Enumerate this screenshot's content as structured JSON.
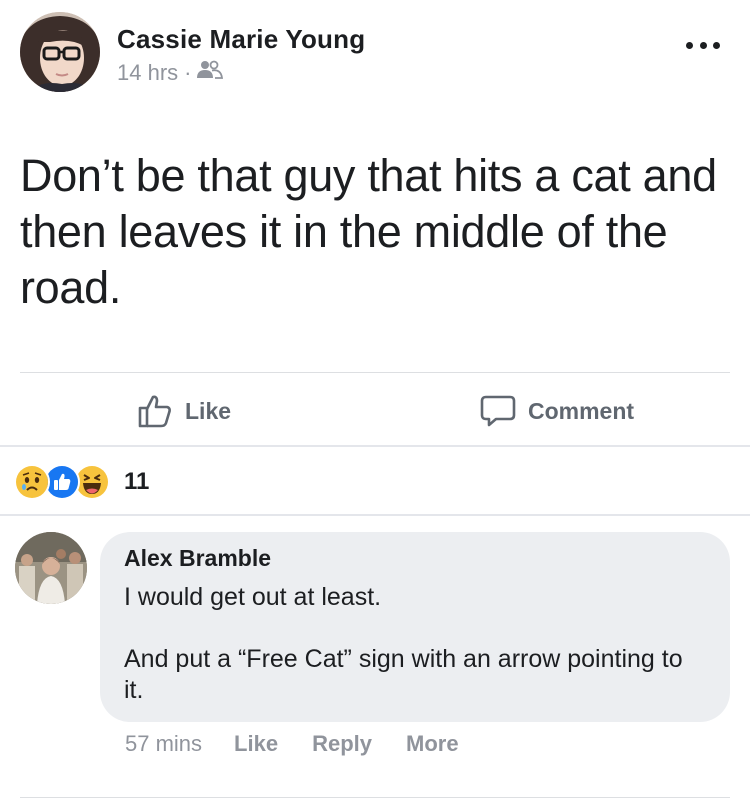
{
  "post": {
    "author": "Cassie Marie Young",
    "time": "14 hrs",
    "separator": "·",
    "audience_icon": "friends-icon",
    "more_icon": "more-options-icon",
    "text": "Don’t be that guy that hits a cat and then leaves it in the middle of the road."
  },
  "actions": {
    "like_label": "Like",
    "comment_label": "Comment"
  },
  "reactions": {
    "icons": [
      "sad-reaction-icon",
      "like-reaction-icon",
      "haha-reaction-icon"
    ],
    "count": "11"
  },
  "comment": {
    "author": "Alex Bramble",
    "text": "I would get out at least.\n\nAnd put a “Free Cat” sign with an arrow pointing to it.",
    "time": "57 mins",
    "like_label": "Like",
    "reply_label": "Reply",
    "more_label": "More"
  },
  "colors": {
    "secondary_text": "#90949c",
    "action_text": "#606770",
    "bubble_bg": "#eceef1",
    "like_blue": "#1877f2",
    "reaction_yellow": "#f7c33d"
  }
}
